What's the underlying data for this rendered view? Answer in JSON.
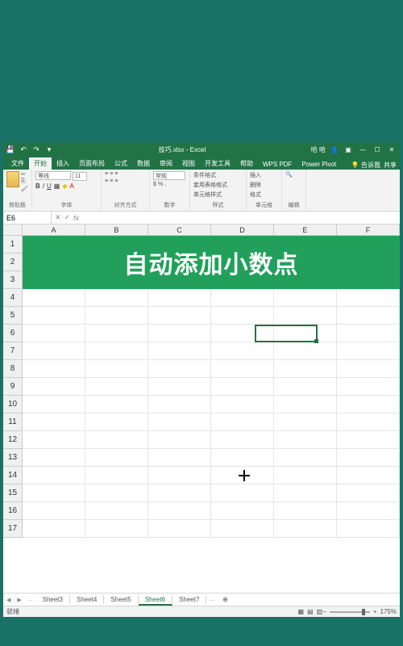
{
  "titlebar": {
    "filename": "技巧.xlsx - Excel",
    "account": "哈 哈"
  },
  "tabs": {
    "file": "文件",
    "home": "开始",
    "insert": "插入",
    "page_layout": "页面布局",
    "formulas": "公式",
    "data": "数据",
    "review": "审阅",
    "view": "视图",
    "developer": "开发工具",
    "help": "帮助",
    "wps": "WPS PDF",
    "power": "Power Pivot",
    "tell_me": "告诉我",
    "share": "共享"
  },
  "ribbon": {
    "clipboard": "剪贴板",
    "font_group": "字体",
    "font_name": "等线",
    "font_size": "11",
    "align": "对齐方式",
    "number_group": "数字",
    "number_format": "常规",
    "styles": "样式",
    "cond_format": "条件格式",
    "table_format": "套用表格格式",
    "cell_styles": "单元格样式",
    "cells_group": "单元格",
    "insert": "插入",
    "delete": "删除",
    "format": "格式",
    "editing": "编辑"
  },
  "namebox": "E6",
  "columns": [
    "A",
    "B",
    "C",
    "D",
    "E",
    "F"
  ],
  "rows": [
    "1",
    "2",
    "3",
    "4",
    "5",
    "6",
    "7",
    "8",
    "9",
    "10",
    "11",
    "12",
    "13",
    "14",
    "15",
    "16",
    "17"
  ],
  "banner_text": "自动添加小数点",
  "sheets": {
    "list": [
      "Sheet3",
      "Sheet4",
      "Sheet5",
      "Sheet6",
      "Sheet7"
    ],
    "active": "Sheet6"
  },
  "status": {
    "ready": "就绪",
    "zoom": "175%"
  }
}
